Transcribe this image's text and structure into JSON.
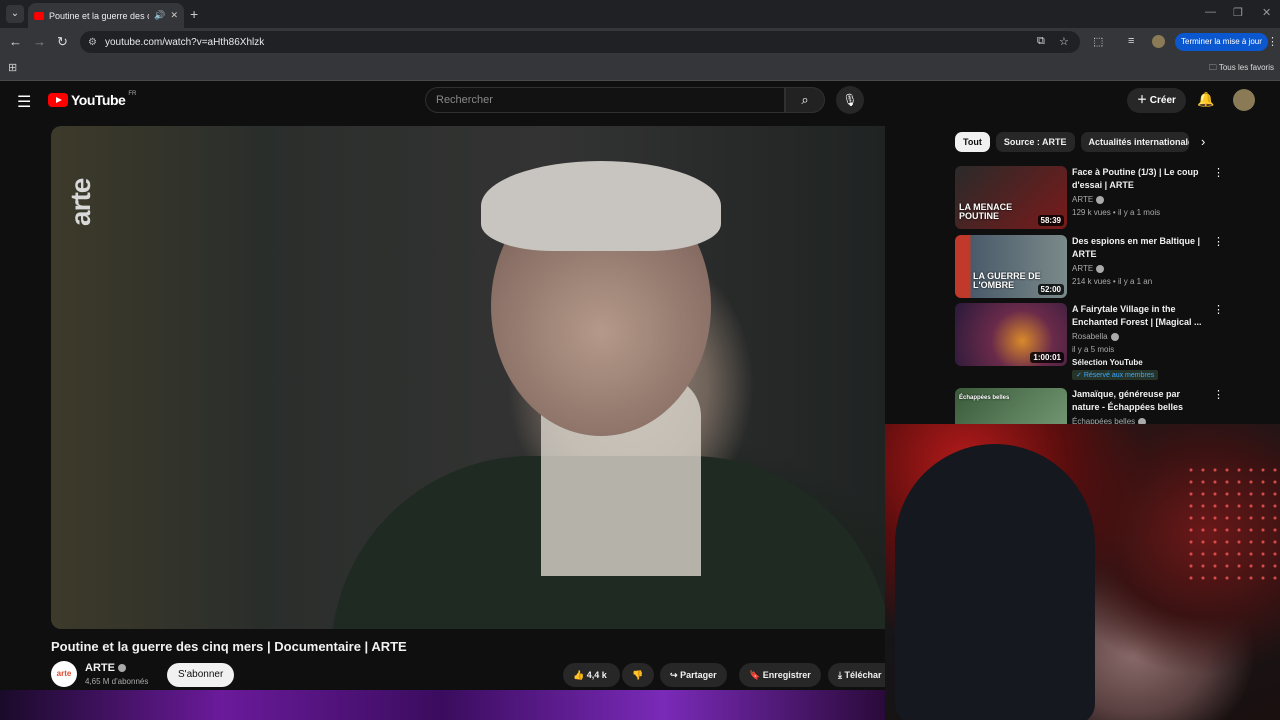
{
  "browser": {
    "tab_title": "Poutine et la guerre des cinq",
    "tab_list_icon": "⌄",
    "sound_icon": "🔊",
    "close_icon": "✕",
    "new_tab": "+",
    "url": "youtube.com/watch?v=aHth86Xhlzk",
    "update_button": "Terminer la mise à jour",
    "bookmarks_folder": "Tous les favoris"
  },
  "header": {
    "logo_text": "YouTube",
    "region": "FR",
    "search_placeholder": "Rechercher",
    "create_label": "Créer"
  },
  "video": {
    "watermark": "arte",
    "title": "Poutine et la guerre des cinq mers | Documentaire | ARTE",
    "channel_avatar_text": "arte",
    "channel": "ARTE",
    "subscribers": "4,65 M d'abonnés",
    "subscribe_label": "S'abonner",
    "likes": "4,4 k",
    "share_label": "Partager",
    "save_label": "Enregistrer",
    "download_label": "Téléchar"
  },
  "chips": [
    "Tout",
    "Source : ARTE",
    "Actualités internationales"
  ],
  "recommendations": [
    {
      "title": "Face à Poutine (1/3) | Le coup d'essai | ARTE",
      "channel": "ARTE",
      "meta": "129 k vues • il y a 1 mois",
      "duration": "58:39",
      "thumb_text": "LA MENACE POUTINE",
      "thumb_colors": [
        "#2a2a2a",
        "#7a1a1a"
      ]
    },
    {
      "title": "Des espions en mer Baltique | ARTE",
      "channel": "ARTE",
      "meta": "214 k vues • il y a 1 an",
      "duration": "52:00",
      "thumb_text": "LA GUERRE DE L'OMBRE",
      "thumb_colors": [
        "#4a5a6a",
        "#c0392b"
      ]
    },
    {
      "title": "A Fairytale Village in the Enchanted Forest | [Magical ...",
      "channel": "Rosabella",
      "meta": "il y a 5 mois",
      "extra": "Sélection YouTube",
      "badge": "Réservé aux membres",
      "duration": "1:00:01",
      "thumb_text": "",
      "thumb_colors": [
        "#3a1a4a",
        "#d98a2a"
      ]
    },
    {
      "title": "Jamaïque, généreuse par nature - Échappées belles",
      "channel": "Échappées belles",
      "meta": "",
      "duration": "",
      "thumb_text": "Échappées belles",
      "thumb_colors": [
        "#3a5a3a",
        "#7aa07a"
      ]
    }
  ],
  "colors": {
    "accent_red": "#ff0000",
    "update_blue": "#0b57d0"
  }
}
